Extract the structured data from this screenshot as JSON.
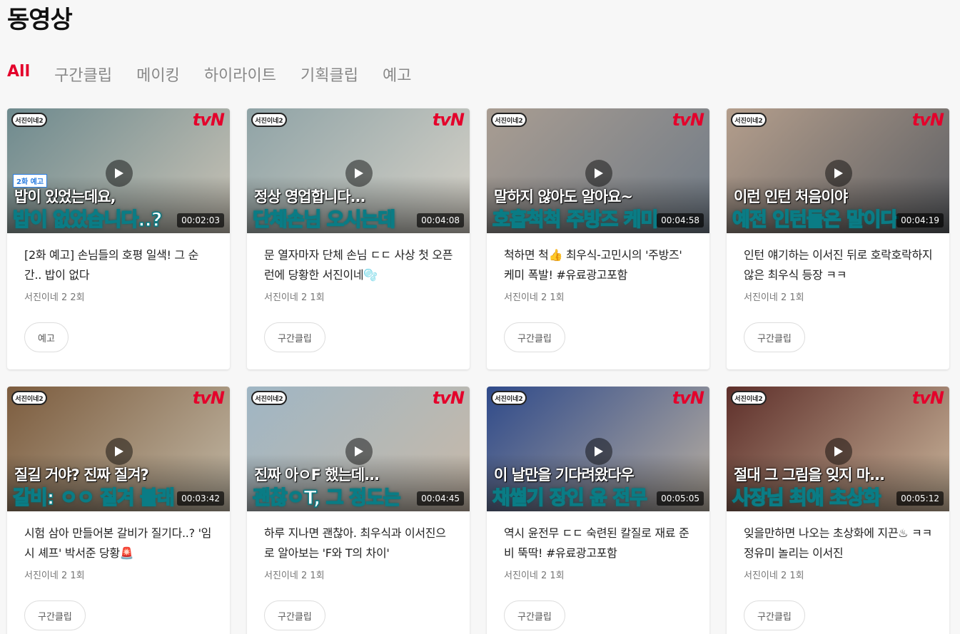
{
  "page": {
    "title": "동영상"
  },
  "tabs": [
    {
      "label": "All",
      "active": true
    },
    {
      "label": "구간클립",
      "active": false
    },
    {
      "label": "메이킹",
      "active": false
    },
    {
      "label": "하이라이트",
      "active": false
    },
    {
      "label": "기획클립",
      "active": false
    },
    {
      "label": "예고",
      "active": false
    }
  ],
  "colors": {
    "accent": "#e4002b",
    "caption_outline": "#0a7c85"
  },
  "videos": [
    {
      "brand": "tvN",
      "badge": "서진이네2",
      "tag": "2화 예고",
      "caption1": "밥이 있었는데요,",
      "caption2": "밥이 없었습니다..?",
      "duration": "00:02:03",
      "title": "[2화 예고] 손님들의 호평 일색! 그 순간.. 밥이 없다",
      "meta": "서진이네 2 2회",
      "chip": "예고",
      "bg": [
        "#6e8a8e",
        "#c9c3b6"
      ]
    },
    {
      "brand": "tvN",
      "badge": "서진이네2",
      "caption1": "정상 영업합니다...",
      "caption2": "단체손님 오시는데",
      "duration": "00:04:08",
      "title": "문 열자마자 단체 손님 ㄷㄷ 사상 첫 오픈런에 당황한 서진이네🫧",
      "meta": "서진이네 2 1회",
      "chip": "구간클립",
      "bg": [
        "#8fa3a6",
        "#d7d2c8"
      ]
    },
    {
      "brand": "tvN",
      "badge": "서진이네2",
      "caption1": "말하지 않아도 알아요~",
      "caption2": "호흡척척 주방즈 케미",
      "duration": "00:04:58",
      "title": "척하면 척👍 최우식-고민시의 '주방즈' 케미 폭발! #유료광고포함",
      "meta": "서진이네 2 1회",
      "chip": "구간클립",
      "bg": [
        "#a99d92",
        "#6f7a86"
      ]
    },
    {
      "brand": "tvN",
      "badge": "서진이네2",
      "caption1": "이런 인턴 처음이야",
      "caption2": "예전 인턴들은 말이다",
      "duration": "00:04:19",
      "title": "인턴 얘기하는 이서진 뒤로 호락호락하지 않은 최우식 등장 ㅋㅋ",
      "meta": "서진이네 2 1회",
      "chip": "구간클립",
      "bg": [
        "#b49e8c",
        "#5b5e63"
      ]
    },
    {
      "brand": "tvN",
      "badge": "서진이네2",
      "caption1": "질길 거야? 진짜 질겨?",
      "caption2": "갈비: ㅇㅇ 질겨 볼래",
      "duration": "00:03:42",
      "title": "시험 삼아 만들어본 갈비가 질기다..? '임시 셰프' 박서준 당황🚨",
      "meta": "서진이네 2 1회",
      "chip": "구간클립",
      "bg": [
        "#7c5c3e",
        "#c2b8a5"
      ]
    },
    {
      "brand": "tvN",
      "badge": "서진이네2",
      "caption1": "진짜 아ㅇF 했는데...",
      "caption2": "괜찮ㅇT, 그 정도는",
      "duration": "00:04:45",
      "title": "하루 지나면 괜찮아. 최우식과 이서진으로 알아보는 'F와 T의 차이'",
      "meta": "서진이네 2 1회",
      "chip": "구간클립",
      "bg": [
        "#9fb6c4",
        "#c8b9a8"
      ]
    },
    {
      "brand": "tvN",
      "badge": "서진이네2",
      "caption1": "이 날만을 기다려왔다우",
      "caption2": "채썰기 장인 윤 전무",
      "duration": "00:05:05",
      "title": "역시 윤전무 ㄷㄷ 숙련된 칼질로 재료 준비 뚝딱! #유료광고포함",
      "meta": "서진이네 2 1회",
      "chip": "구간클립",
      "bg": [
        "#2f4a8a",
        "#b8aea0"
      ]
    },
    {
      "brand": "tvN",
      "badge": "서진이네2",
      "caption1": "절대 그 그림을 잊지 마...",
      "caption2": "사장님 최애 초상화",
      "duration": "00:05:12",
      "title": "잊을만하면 나오는 초상화에 지끈♨ ㅋㅋ 정유미 놀리는 이서진",
      "meta": "서진이네 2 1회",
      "chip": "구간클립",
      "bg": [
        "#5e2f2a",
        "#c9b49a"
      ]
    }
  ]
}
